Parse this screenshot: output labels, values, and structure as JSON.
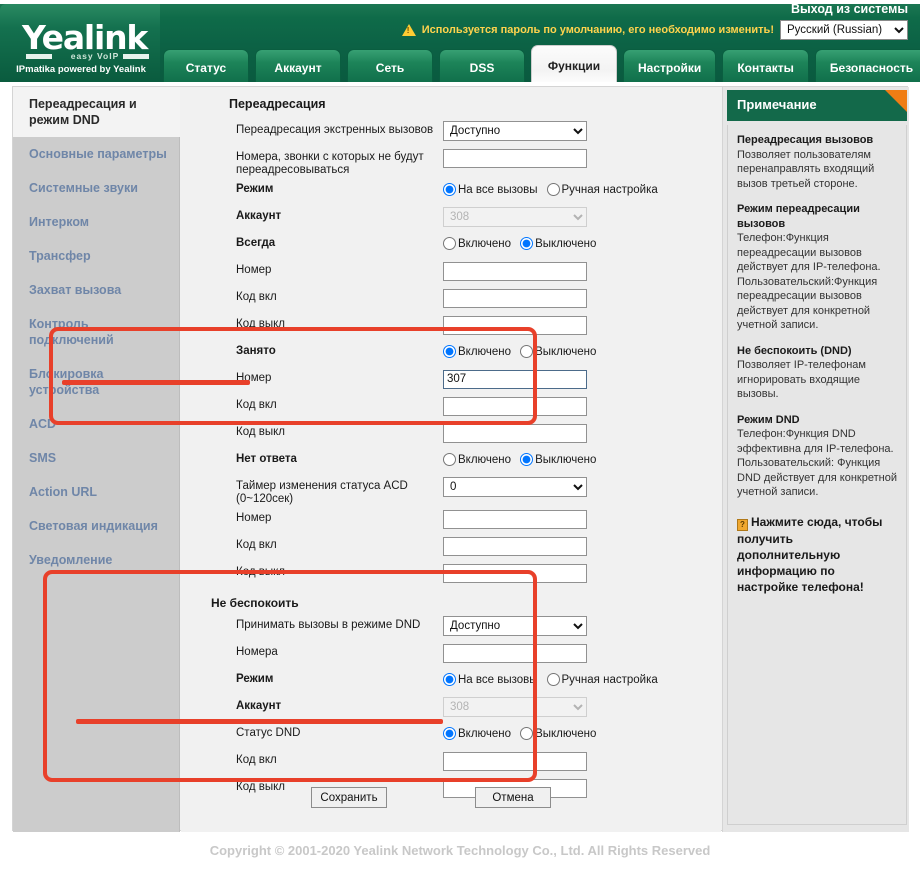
{
  "header": {
    "logo_main": "Yealink",
    "logo_sub": "easy VoIP",
    "logo_tagline": "IPmatika powered by Yealink",
    "logout_label": "Выход из системы",
    "warning_text": "Используется пароль по умолчанию, его необходимо изменить!",
    "warning_icon": "warning-triangle-icon",
    "language_selected": "Русский (Russian)",
    "accent_green": "#0c6245",
    "warning_yellow": "#ffd34d"
  },
  "tabs": [
    {
      "label": "Статус",
      "active": false
    },
    {
      "label": "Аккаунт",
      "active": false
    },
    {
      "label": "Сеть",
      "active": false
    },
    {
      "label": "DSS",
      "active": false
    },
    {
      "label": "Функции",
      "active": true
    },
    {
      "label": "Настройки",
      "active": false
    },
    {
      "label": "Контакты",
      "active": false
    },
    {
      "label": "Безопасность",
      "active": false
    }
  ],
  "sidebar": {
    "items": [
      {
        "label": "Переадресация и режим DND",
        "active": true
      },
      {
        "label": "Основные параметры",
        "active": false
      },
      {
        "label": "Системные звуки",
        "active": false
      },
      {
        "label": "Интерком",
        "active": false
      },
      {
        "label": "Трансфер",
        "active": false
      },
      {
        "label": "Захват вызова",
        "active": false
      },
      {
        "label": "Контроль подключений",
        "active": false
      },
      {
        "label": "Блокировка устройства",
        "active": false
      },
      {
        "label": "ACD",
        "active": false
      },
      {
        "label": "SMS",
        "active": false
      },
      {
        "label": "Action URL",
        "active": false
      },
      {
        "label": "Световая индикация",
        "active": false
      },
      {
        "label": "Уведомление",
        "active": false
      }
    ]
  },
  "form": {
    "title": "Переадресация",
    "emergency_forward_label": "Переадресация экстренных вызовов",
    "emergency_forward_value": "Доступно",
    "exclude_numbers_label": "Номера, звонки с которых не будут переадресовываться",
    "exclude_numbers_value": "",
    "mode_label": "Режим",
    "mode_opt_all": "На все вызовы",
    "mode_opt_custom": "Ручная настройка",
    "account_label": "Аккаунт",
    "account_value": "308",
    "always_label": "Всегда",
    "radio_on": "Включено",
    "radio_off": "Выключено",
    "number_label": "Номер",
    "numbers_label": "Номера",
    "code_on_label": "Код вкл",
    "code_off_label": "Код выкл",
    "always_number_value": "",
    "always_code_on_value": "",
    "always_code_off_value": "",
    "busy_label": "Занято",
    "busy_number_value": "307",
    "busy_code_on_value": "",
    "busy_code_off_value": "",
    "noanswer_label": "Нет ответа",
    "acd_timer_label": "Таймер изменения статуса ACD (0~120сек)",
    "acd_timer_value": "0",
    "noanswer_number_value": "",
    "noanswer_code_on_value": "",
    "noanswer_code_off_value": "",
    "dnd_section_title": "Не беспокоить",
    "dnd_accept_label": "Принимать вызовы в режиме DND",
    "dnd_accept_value": "Доступно",
    "dnd_numbers_value": "",
    "dnd_account_value": "308",
    "dnd_status_label": "Статус DND",
    "dnd_code_on_value": "",
    "dnd_code_off_value": "",
    "save_label": "Сохранить",
    "cancel_label": "Отмена",
    "highlight_color": "#e8402a"
  },
  "note": {
    "title": "Примечание",
    "blocks": [
      {
        "heading": "Переадресация вызовов",
        "text": "Позволяет пользователям перенаправлять входящий вызов третьей стороне."
      },
      {
        "heading": "Режим переадресации вызовов",
        "text": "Телефон:Функция переадресации вызовов действует для IP-телефона. Пользовательский:Функция переадресации вызовов действует для конкретной учетной записи."
      },
      {
        "heading": "Не беспокоить (DND)",
        "text": "Позволяет IP-телефонам игнорировать входящие вызовы."
      },
      {
        "heading": "Режим DND",
        "text": "Телефон:Функция DND эффективна для IP-телефона. Пользовательский: Функция DND действует для конкретной учетной записи."
      }
    ],
    "cta": "Нажмите сюда, чтобы получить дополнительную информацию по настройке телефона!",
    "cta_icon": "help-book-icon"
  },
  "footer": {
    "text": "Copyright © 2001-2020 Yealink Network Technology Co., Ltd. All Rights Reserved"
  }
}
